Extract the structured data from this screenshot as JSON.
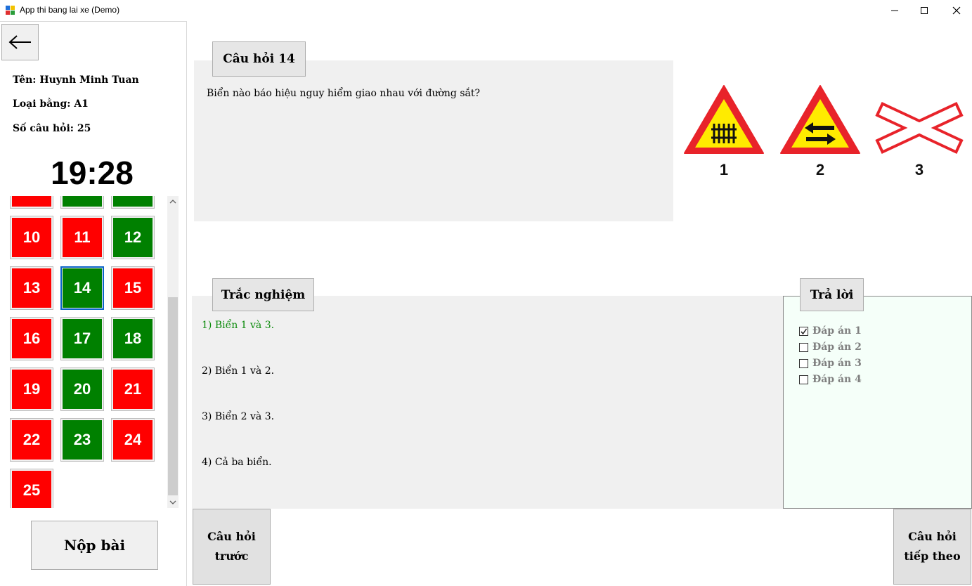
{
  "window": {
    "title": "App thi bang lai xe (Demo)"
  },
  "sidebar": {
    "name_line": "Tên: Huynh Minh Tuan",
    "license_line": "Loại bằng: A1",
    "count_line": "Số câu hỏi: 25",
    "timer": "19:28",
    "submit_label": "Nộp bài",
    "current_question": 14,
    "questions": [
      {
        "number": "",
        "status": "wrong"
      },
      {
        "number": "",
        "status": "correct"
      },
      {
        "number": "",
        "status": "correct"
      },
      {
        "number": "10",
        "status": "wrong"
      },
      {
        "number": "11",
        "status": "wrong"
      },
      {
        "number": "12",
        "status": "correct"
      },
      {
        "number": "13",
        "status": "wrong"
      },
      {
        "number": "14",
        "status": "correct"
      },
      {
        "number": "15",
        "status": "wrong"
      },
      {
        "number": "16",
        "status": "wrong"
      },
      {
        "number": "17",
        "status": "correct"
      },
      {
        "number": "18",
        "status": "correct"
      },
      {
        "number": "19",
        "status": "wrong"
      },
      {
        "number": "20",
        "status": "correct"
      },
      {
        "number": "21",
        "status": "wrong"
      },
      {
        "number": "22",
        "status": "wrong"
      },
      {
        "number": "23",
        "status": "correct"
      },
      {
        "number": "24",
        "status": "wrong"
      },
      {
        "number": "25",
        "status": "wrong"
      }
    ]
  },
  "colors": {
    "wrong": "#ff0000",
    "correct": "#008000",
    "selected_option": "#0a8a0a"
  },
  "question": {
    "label": "Câu hỏi 14",
    "text": "Biển nào báo hiệu nguy hiểm giao nhau với đường sắt?",
    "sign_labels": [
      "1",
      "2",
      "3"
    ]
  },
  "options": {
    "label": "Trắc nghiệm",
    "items": [
      "1) Biển 1 và 3.",
      "2) Biển 1 và 2.",
      "3) Biển 2 và 3.",
      "4) Cả ba biển."
    ]
  },
  "answers": {
    "label": "Trả lời",
    "items": [
      {
        "label": "Đáp án 1",
        "checked": true
      },
      {
        "label": "Đáp án 2",
        "checked": false
      },
      {
        "label": "Đáp án 3",
        "checked": false
      },
      {
        "label": "Đáp án 4",
        "checked": false
      }
    ]
  },
  "nav": {
    "prev_line1": "Câu hỏi",
    "prev_line2": "trước",
    "next_line1": "Câu hỏi",
    "next_line2": "tiếp theo"
  }
}
